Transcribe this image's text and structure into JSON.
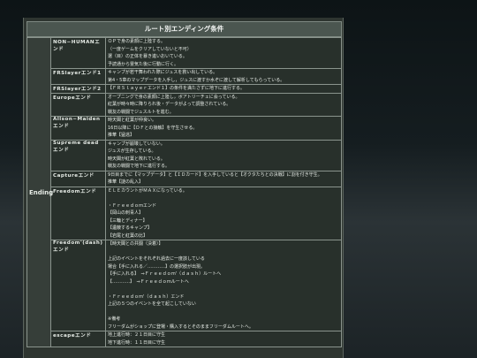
{
  "caption": "ルート別エンディング条件",
  "group_label": "Ending",
  "rows": [
    {
      "name": "NON−HUMANエンド",
      "lines": [
        "ＯＰで身の素顔に上陸する。",
        "（一度ゲームをクリアしていないと不可）",
        "選（目）の正体を暴き進いおいている。",
        "予読通から霊気た後に行動に行く。"
      ]
    },
    {
      "name": "FRSlayerエンド1",
      "lines": [
        "キャンプが若干舞われた際にジュスを救い出している。",
        "第4・5章のマップデータを入手し，ジュスに渡すか水ぞに渡して解析してもらっている。"
      ]
    },
    {
      "name": "FRSlayerエンド2",
      "lines": [
        "【ＦＲＳｌａｙｅｒエンド１】の条件を満たさずに地下に進行する。"
      ]
    },
    {
      "name": "Europeエンド",
      "lines": [
        "オープニングで身の素顔に上陸し，ボアトリーチェに会っている。",
        "紅葉が時々時に降りられ後・データがよって調整されている。",
        "戦友の戦闘でジュスルトを進む。"
      ]
    },
    {
      "name": "Allson−Maidenエンド",
      "lines": [
        "時天閣と紅葉が仲良い。",
        "16日以降に【ＤＦとの接触】を守生させる。",
        "推華【猛逃】"
      ]
    },
    {
      "name": "Supreme deadエンド",
      "lines": [
        "キャンプが崩壊していない。",
        "ジュスが生存している。",
        "時天閣が紅葉と敗れている。",
        "戦友の戦闘で地下に進行する。"
      ]
    },
    {
      "name": "Captureエンド",
      "lines": [
        "9日目までに【マップデータ】と【ＩＤカード】を入手していると【オクタたちとの決戦】に割を付き守生。",
        "推華【謎の乱入】"
      ]
    },
    {
      "name": "Freedomエンド",
      "lines": [
        "ＥＬＥカウントがＭＡＸになっている。",
        "",
        "・Ｆｒｅｅｄｏｍエンド",
        "【岡山の刺青人】",
        "【三輪とディナー】",
        "【遺蔽するキャンプ】",
        "【岩尾と紅葉の比】"
      ]
    },
    {
      "name": "Freedom'(dash)エンド",
      "lines": [
        "【時天閣との共闘（決着）】",
        "",
        "上記のイベントをそれぞれ過去に一度該している",
        "場合【手に入れる／…………】の選択肢が出現。",
        "【手に入れる】　⇒Ｆｒｅｅｄｏｍ'（ｄａｓｈ）ルートへ",
        "【…………】　⇒Ｆｒｅｅｄｏｍルートへ",
        "",
        "・Ｆｒｅｅｄｏｍ'（ｄａｓｈ）エンド",
        "上記の５つのイベントを全て起こしていない",
        "",
        "※備考",
        "フリーダムがショップに登場・購入するとそのままフリーダムルートへ。"
      ]
    },
    {
      "name": "escapeエンド",
      "lines": [
        "地上進行時：２１日目に守生",
        "地下進行時：１１日目に守生"
      ]
    }
  ]
}
